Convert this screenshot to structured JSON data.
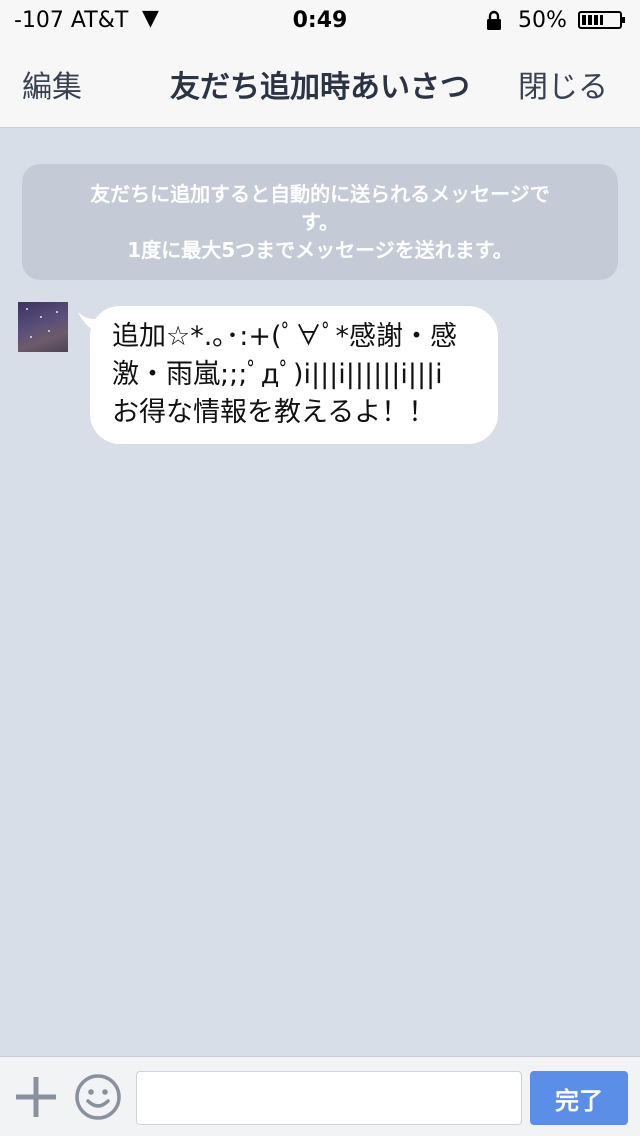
{
  "status_bar": {
    "carrier": "-107 AT&T",
    "signal_icon": "location-arrow-icon",
    "time": "0:49",
    "lock_icon": "lock-icon",
    "battery_percent": "50%",
    "battery_icon": "battery-icon"
  },
  "nav": {
    "edit_label": "編集",
    "title": "友だち追加時あいさつ",
    "close_label": "閉じる"
  },
  "info_banner": {
    "line1": "友だちに追加すると自動的に送られるメッセージで",
    "line2": "す。",
    "line3": "1度に最大5つまでメッセージを送れます。"
  },
  "message": {
    "line1": "追加☆*.｡･:+(ﾟ∀ﾟ*感謝・感",
    "line2": "激・雨嵐;;;ﾟдﾟ)i|||i||||||i|||i",
    "line3": "お得な情報を教えるよ！！"
  },
  "input_bar": {
    "plus_icon": "plus-icon",
    "emoji_icon": "smiley-icon",
    "input_value": "",
    "input_placeholder": "",
    "done_label": "完了"
  },
  "colors": {
    "background": "#d8dee7",
    "banner": "#c4cbd6",
    "done_button": "#5b8ee6",
    "nav_text": "#384152"
  }
}
